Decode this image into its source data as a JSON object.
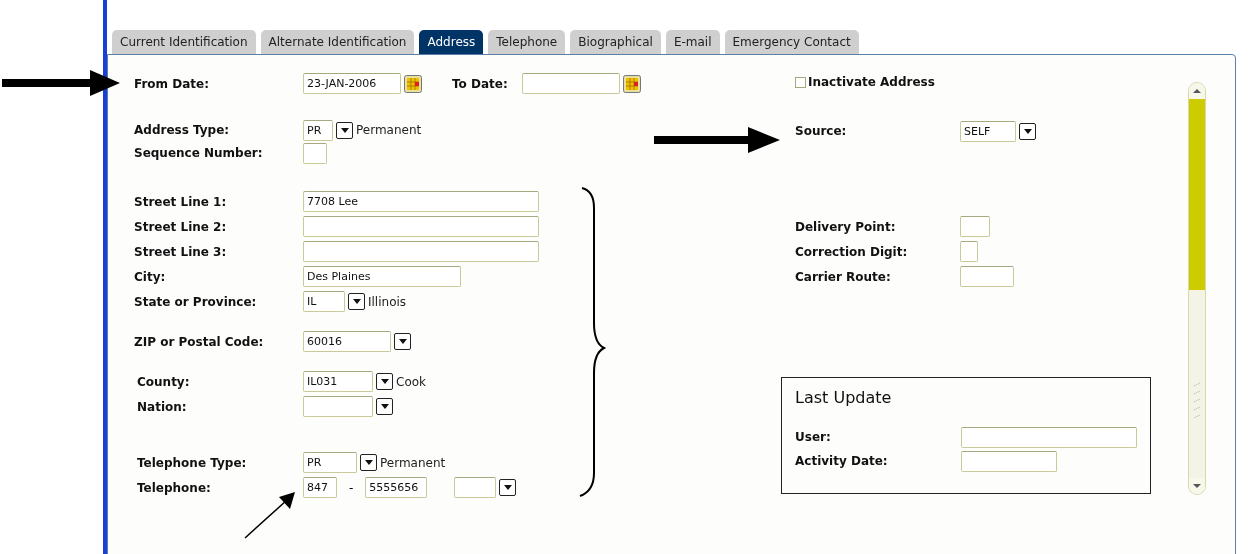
{
  "tabs": [
    {
      "label": "Current Identification",
      "selected": false
    },
    {
      "label": "Alternate Identification",
      "selected": false
    },
    {
      "label": "Address",
      "selected": true
    },
    {
      "label": "Telephone",
      "selected": false
    },
    {
      "label": "Biographical",
      "selected": false
    },
    {
      "label": "E-mail",
      "selected": false
    },
    {
      "label": "Emergency Contact",
      "selected": false
    }
  ],
  "dates": {
    "from": {
      "label": "From Date:",
      "value": "23-JAN-2006"
    },
    "to": {
      "label": "To Date:"
    }
  },
  "fields": [
    {
      "kind": "select",
      "label": "Address Type:",
      "value": "PR",
      "description": "Permanent"
    },
    {
      "kind": "text",
      "label": "Sequence Number:"
    },
    {
      "kind": "text",
      "label": "Street Line 1:",
      "value": "7708 Lee"
    },
    {
      "kind": "text",
      "label": "Street Line 2:"
    },
    {
      "kind": "text",
      "label": "Street Line 3:"
    },
    {
      "kind": "text",
      "label": "City:",
      "value": "Des Plaines"
    },
    {
      "kind": "select",
      "label": "State or Province:",
      "value": "IL",
      "description": "Illinois"
    },
    {
      "kind": "select",
      "label": "ZIP or Postal Code:",
      "value": "60016"
    },
    {
      "kind": "select",
      "label": "County:",
      "value": "IL031",
      "description": "Cook"
    },
    {
      "kind": "select",
      "label": "Nation:"
    },
    {
      "kind": "select",
      "label": "Telephone Type:",
      "value": "PR",
      "description": "Permanent"
    },
    {
      "kind": "phone",
      "label": "Telephone:",
      "area_code": "847",
      "separator": "-",
      "number": "5555656"
    }
  ],
  "inactivate": {
    "label": "Inactivate Address",
    "checked": false
  },
  "source": {
    "label": "Source:",
    "value": "SELF"
  },
  "delivery_fields": [
    {
      "label": "Delivery Point:"
    },
    {
      "label": "Correction Digit:"
    },
    {
      "label": "Carrier Route:"
    }
  ],
  "last_update": {
    "title": "Last Update",
    "fields": [
      {
        "label": "User:"
      },
      {
        "label": "Activity Date:"
      }
    ]
  }
}
